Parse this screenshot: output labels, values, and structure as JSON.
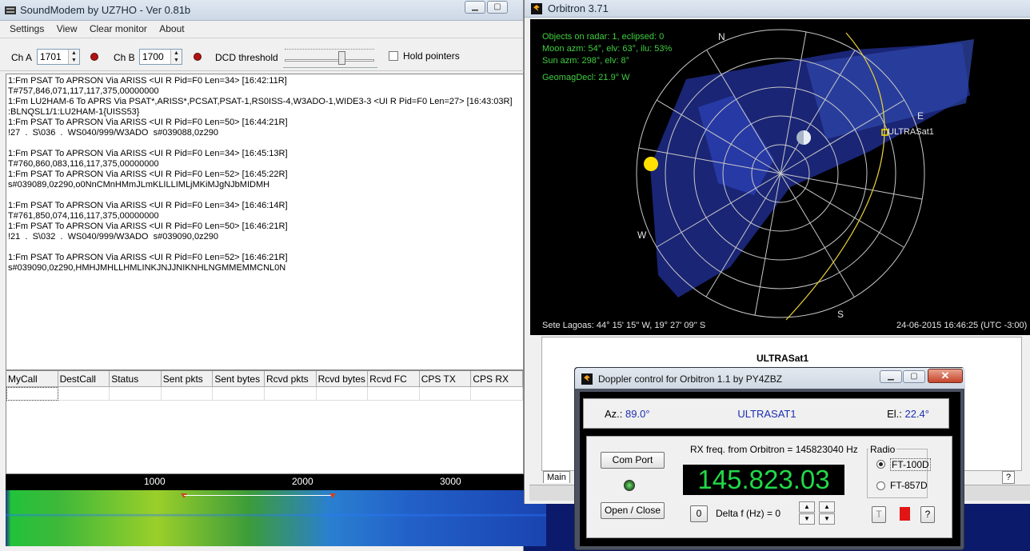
{
  "soundmodem": {
    "title": "SoundModem by UZ7HO - Ver 0.81b",
    "menu": [
      "Settings",
      "View",
      "Clear monitor",
      "About"
    ],
    "cha_label": "Ch A",
    "cha_value": "1701",
    "chb_label": "Ch B",
    "chb_value": "1700",
    "dcd_label": "DCD threshold",
    "hold_label": "Hold pointers",
    "monitor_lines": [
      "1:Fm PSAT To APRSON Via ARISS <UI R Pid=F0 Len=34> [16:42:11R]",
      "T#757,846,071,117,117,375,00000000",
      "1:Fm LU2HAM-6 To APRS Via PSAT*,ARISS*,PCSAT,PSAT-1,RS0ISS-4,W3ADO-1,WIDE3-3 <UI R Pid=F0 Len=27> [16:43:03R]",
      ":BLNQSL1/1:LU2HAM-1{UISS53}",
      "1:Fm PSAT To APRSON Via ARISS <UI R Pid=F0 Len=50> [16:44:21R]",
      "!27  .  S\\036  .  WS040/999/W3ADO  s#039088,0z290",
      "",
      "1:Fm PSAT To APRSON Via ARISS <UI R Pid=F0 Len=34> [16:45:13R]",
      "T#760,860,083,116,117,375,00000000",
      "1:Fm PSAT To APRSON Via ARISS <UI R Pid=F0 Len=52> [16:45:22R]",
      "s#039089,0z290,o0NnCMnHMmJLmKLILLIMLjMKiMJgNJbMIDMH",
      "",
      "1:Fm PSAT To APRSON Via ARISS <UI R Pid=F0 Len=34> [16:46:14R]",
      "T#761,850,074,116,117,375,00000000",
      "1:Fm PSAT To APRSON Via ARISS <UI R Pid=F0 Len=50> [16:46:21R]",
      "!21  .  S\\032  .  WS040/999/W3ADO  s#039090,0z290",
      "",
      "1:Fm PSAT To APRSON Via ARISS <UI R Pid=F0 Len=52> [16:46:21R]",
      "s#039090,0z290,HMHJMHLLHMLINKJNJJNIKNHLNGMMEMMCNL0N"
    ],
    "grid_headers": [
      "MyCall",
      "DestCall",
      "Status",
      "Sent pkts",
      "Sent bytes",
      "Rcvd pkts",
      "Rcvd bytes",
      "Rcvd FC",
      "CPS TX",
      "CPS RX"
    ],
    "scale": [
      "1000",
      "2000",
      "3000"
    ]
  },
  "orbitron": {
    "title": "Orbitron 3.71",
    "info": [
      "Objects on radar: 1, eclipsed: 0",
      "Moon azm: 54°, elv: 63°, ilu: 53%",
      "Sun azm: 298°, elv: 8°",
      "GeomagDecl: 21.9° W"
    ],
    "compass": {
      "n": "N",
      "e": "E",
      "s": "S",
      "w": "W"
    },
    "sat_label": "ULTRASat1",
    "location": "Sete Lagoas: 44° 15' 15'' W, 19° 27' 09'' S",
    "datetime": "24-06-2015 16:46:25 (UTC -3:00)",
    "panel_sat": "ULTRASat1",
    "tab": "Main",
    "help": "?"
  },
  "doppler": {
    "title": "Doppler control for Orbitron   1.1     by  PY4ZBZ",
    "az_label": "Az.:",
    "az_value": "89.0°",
    "sat": "ULTRASAT1",
    "el_label": "El.:",
    "el_value": "22.4°",
    "rx_label": "RX freq. from Orbitron =  145823040 Hz",
    "freq": "145.823.03",
    "com_port": "Com Port",
    "open_close": "Open / Close",
    "zero": "0",
    "delta_label": "Delta f (Hz) =  0",
    "radio_group": "Radio",
    "radio_1": "FT-100D",
    "radio_2": "FT-857D",
    "btn_t": "T",
    "btn_help": "?"
  },
  "colors": {
    "freq": "#21d948",
    "radar_text": "#3fcf3f",
    "sat_value": "#1b2fb0"
  }
}
